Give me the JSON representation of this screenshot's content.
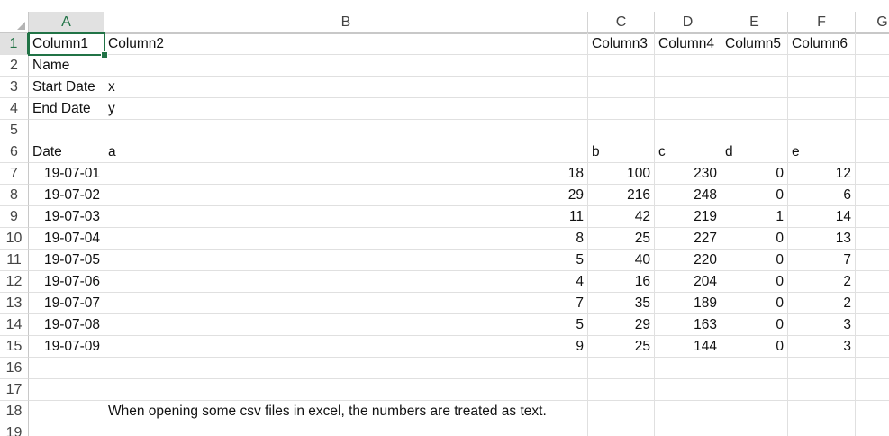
{
  "columns": [
    {
      "label": "A",
      "selected": true
    },
    {
      "label": "B"
    },
    {
      "label": "C"
    },
    {
      "label": "D"
    },
    {
      "label": "E"
    },
    {
      "label": "F"
    },
    {
      "label": "G"
    }
  ],
  "rows": [
    {
      "num": "1",
      "cells": [
        "Column1",
        "Column2",
        "Column3",
        "Column4",
        "Column5",
        "Column6",
        ""
      ]
    },
    {
      "num": "2",
      "cells": [
        "Name",
        "",
        "",
        "",
        "",
        "",
        ""
      ]
    },
    {
      "num": "3",
      "cells": [
        "Start Date",
        "x",
        "",
        "",
        "",
        "",
        ""
      ]
    },
    {
      "num": "4",
      "cells": [
        "End Date",
        "y",
        "",
        "",
        "",
        "",
        ""
      ]
    },
    {
      "num": "5",
      "cells": [
        "",
        "",
        "",
        "",
        "",
        "",
        ""
      ]
    },
    {
      "num": "6",
      "cells": [
        "Date",
        "a",
        "b",
        "c",
        "d",
        "e",
        ""
      ]
    },
    {
      "num": "7",
      "cells": [
        "19-07-01",
        "18",
        "100",
        "230",
        "0",
        "12",
        ""
      ]
    },
    {
      "num": "8",
      "cells": [
        "19-07-02",
        "29",
        "216",
        "248",
        "0",
        "6",
        ""
      ]
    },
    {
      "num": "9",
      "cells": [
        "19-07-03",
        "11",
        "42",
        "219",
        "1",
        "14",
        ""
      ]
    },
    {
      "num": "10",
      "cells": [
        "19-07-04",
        "8",
        "25",
        "227",
        "0",
        "13",
        ""
      ]
    },
    {
      "num": "11",
      "cells": [
        "19-07-05",
        "5",
        "40",
        "220",
        "0",
        "7",
        ""
      ]
    },
    {
      "num": "12",
      "cells": [
        "19-07-06",
        "4",
        "16",
        "204",
        "0",
        "2",
        ""
      ]
    },
    {
      "num": "13",
      "cells": [
        "19-07-07",
        "7",
        "35",
        "189",
        "0",
        "2",
        ""
      ]
    },
    {
      "num": "14",
      "cells": [
        "19-07-08",
        "5",
        "29",
        "163",
        "0",
        "3",
        ""
      ]
    },
    {
      "num": "15",
      "cells": [
        "19-07-09",
        "9",
        "25",
        "144",
        "0",
        "3",
        ""
      ]
    },
    {
      "num": "16",
      "cells": [
        "",
        "",
        "",
        "",
        "",
        "",
        ""
      ]
    },
    {
      "num": "17",
      "cells": [
        "",
        "",
        "",
        "",
        "",
        "",
        ""
      ]
    },
    {
      "num": "18",
      "cells": [
        "",
        "When opening some csv files in excel, the numbers are treated as text.",
        "",
        "",
        "",
        "",
        ""
      ]
    },
    {
      "num": "19",
      "cells": [
        "",
        "",
        "",
        "",
        "",
        "",
        ""
      ]
    }
  ],
  "active_cell": "A1",
  "colors": {
    "accent": "#217346",
    "gridline": "#e0e0e0"
  }
}
